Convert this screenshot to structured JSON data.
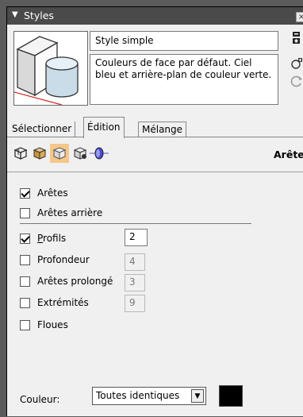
{
  "panel": {
    "title": "Styles",
    "collapse_glyph": "▼",
    "close_glyph": "×"
  },
  "style": {
    "name": "Style simple",
    "description": "Couleurs de face par défaut. Ciel bleu et arrière-plan de couleur verte.",
    "thumbnail_icon": "box-cylinder-preview-icon"
  },
  "side_icons": [
    "create-style-icon",
    "update-style-icon",
    "refresh-icon"
  ],
  "tabs": [
    {
      "label": "Sélectionner",
      "active": false
    },
    {
      "label": "Édition",
      "active": true
    },
    {
      "label": "Mélange",
      "active": false
    }
  ],
  "toolbar": {
    "tools": [
      "edge-settings-icon",
      "face-settings-icon",
      "background-settings-icon",
      "watermark-settings-icon",
      "modeling-settings-icon"
    ],
    "selected_index": 2,
    "section_label": "Arête"
  },
  "edges": {
    "aretes": {
      "label": "Arêtes",
      "checked": true
    },
    "aretes_arriere": {
      "label": "Arêtes arrière",
      "checked": false
    },
    "profils": {
      "label": "Profils",
      "checked": true,
      "value": "2"
    },
    "profondeur": {
      "label": "Profondeur",
      "checked": false,
      "value": "4"
    },
    "aretes_prolongees": {
      "label": "Arêtes prolongé",
      "checked": false,
      "value": "3"
    },
    "extremites": {
      "label": "Extrémités",
      "checked": false,
      "value": "9"
    },
    "floues": {
      "label": "Floues",
      "checked": false
    }
  },
  "color": {
    "label": "Couleur:",
    "selected": "Toutes identiques",
    "swatch": "#000000"
  }
}
